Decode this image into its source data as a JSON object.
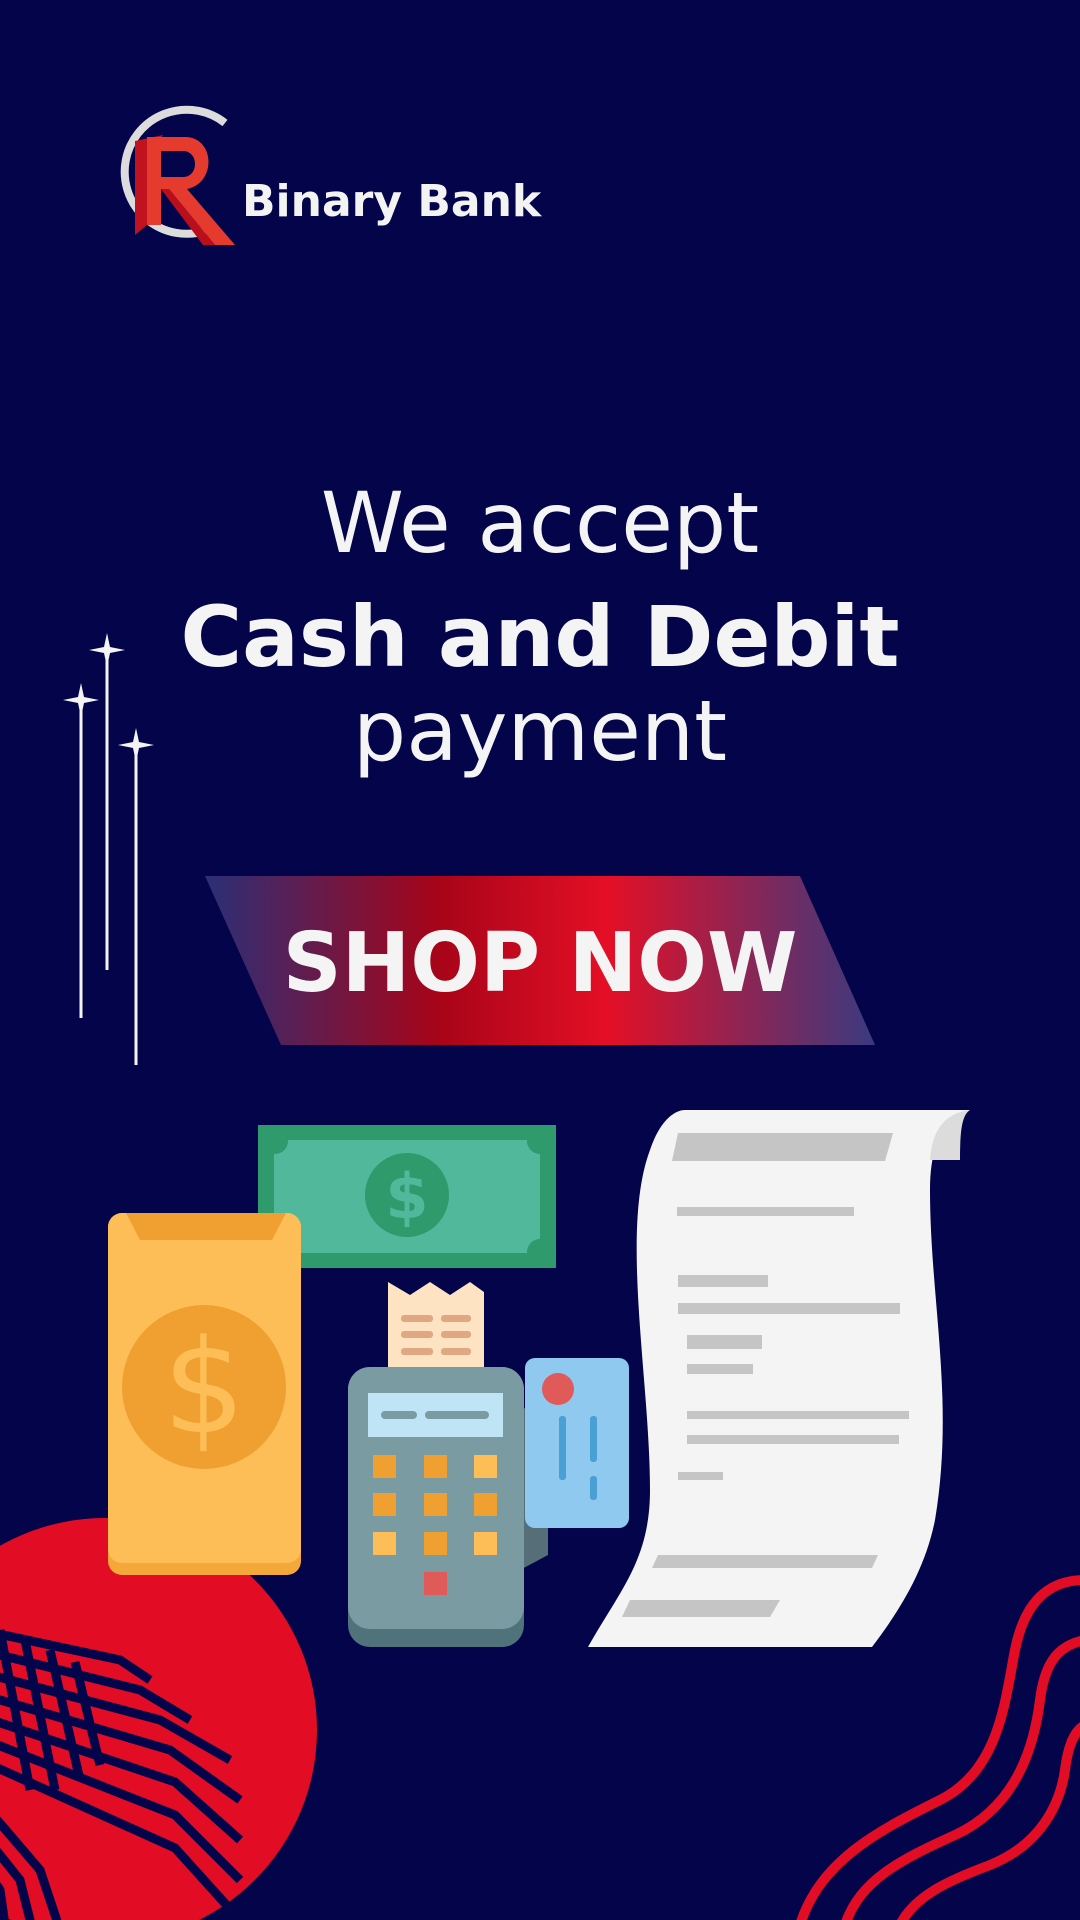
{
  "brand": {
    "name": "Binary Bank",
    "logo_letter": "R",
    "logo_icon": "r-monogram-logo"
  },
  "headline": {
    "line1": "We accept",
    "line2": "Cash and Debit",
    "line3": "payment"
  },
  "cta": {
    "label": "SHOP NOW"
  },
  "illustrations": [
    "smartphone-dollar-icon",
    "banknote-icon",
    "card-terminal-icon",
    "credit-card-icon",
    "receipt-icon",
    "sparkle-icon"
  ],
  "colors": {
    "background": "#03044a",
    "accent_red": "#e20d24",
    "text": "#f4f4f4"
  }
}
